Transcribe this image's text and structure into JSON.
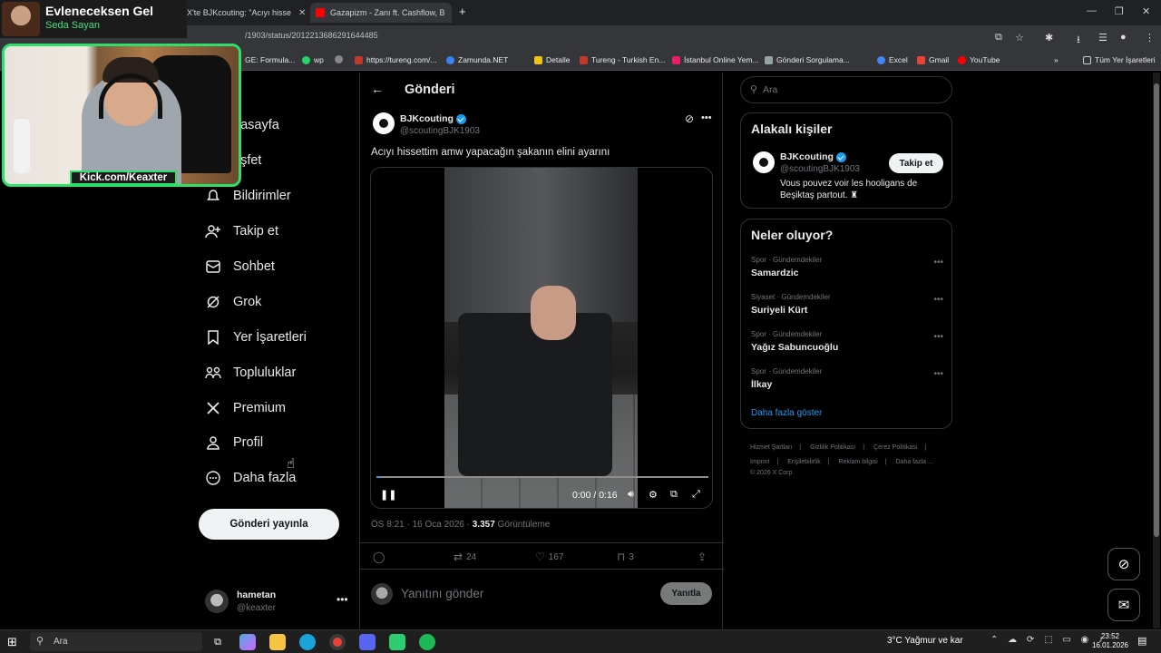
{
  "browser": {
    "tabs": [
      {
        "label": "X'te BJKcouting: \"Acıyı hisse",
        "favicon_color": "#000000"
      },
      {
        "label": "Gazapizm - Zanı ft. Cashflow, B",
        "favicon_color": "#ff0000"
      }
    ],
    "url": "/1903/status/2012213686291644485",
    "bookmarks": [
      {
        "label": "GE: Formula...",
        "color": "#e74c3c"
      },
      {
        "label": "wp",
        "color": "#25d366"
      },
      {
        "label": "https://tureng.com/...",
        "color": "#c0392b"
      },
      {
        "label": "Zamunda.NET",
        "color": "#3b82f6"
      },
      {
        "label": "Detalle",
        "color": "#f1c40f"
      },
      {
        "label": "Tureng - Turkish En...",
        "color": "#c0392b"
      },
      {
        "label": "İstanbul Online Yem...",
        "color": "#e91e63"
      },
      {
        "label": "Gönderi Sorgulama...",
        "color": "#95a5a6"
      },
      {
        "label": "Excel",
        "color": "#4285f4"
      },
      {
        "label": "Gmail",
        "color": "#ea4335"
      },
      {
        "label": "YouTube",
        "color": "#ff0000"
      }
    ],
    "all_bookmarks": "Tüm Yer İşaretleri"
  },
  "overlay": {
    "title": "Evleneceksen Gel",
    "subtitle": "Seda Sayan",
    "channel": "Kick.com/Keaxter"
  },
  "nav": {
    "items": [
      {
        "label": "nasayfa",
        "icon": "home-icon"
      },
      {
        "label": "eşfet",
        "icon": "explore-icon"
      },
      {
        "label": "Bildirimler",
        "icon": "bell-icon"
      },
      {
        "label": "Takip et",
        "icon": "follow-icon"
      },
      {
        "label": "Sohbet",
        "icon": "mail-icon"
      },
      {
        "label": "Grok",
        "icon": "grok-icon"
      },
      {
        "label": "Yer İşaretleri",
        "icon": "bookmark-icon"
      },
      {
        "label": "Topluluklar",
        "icon": "communities-icon"
      },
      {
        "label": "Premium",
        "icon": "x-logo-icon"
      },
      {
        "label": "Profil",
        "icon": "person-icon"
      },
      {
        "label": "Daha fazla",
        "icon": "more-circle-icon"
      }
    ],
    "post_button": "Gönderi yayınla",
    "account": {
      "name": "hametan",
      "handle": "@keaxter"
    }
  },
  "post": {
    "page_title": "Gönderi",
    "author": "BJKcouting",
    "handle": "@scoutingBJK1903",
    "text": "Acıyı hissettim amw yapacağın şakanın elini ayarını",
    "video_time": "0:00 / 0:16",
    "video_progress": 0.01,
    "timestamp": "ÖS 8:21 · 16 Oca 2026 · ",
    "views": "3.357",
    "views_label": " Görüntüleme",
    "retweets": "24",
    "likes": "167",
    "bookmarks": "3",
    "reply_placeholder": "Yanıtını gönder",
    "reply_button": "Yanıtla"
  },
  "sidebar": {
    "search_placeholder": "Ara",
    "related_title": "Alakalı kişiler",
    "related": {
      "name": "BJKcouting",
      "handle": "@scoutingBJK1903",
      "bio": "Vous pouvez voir les hooligans de Beşiktaş partout. ♜",
      "follow": "Takip et"
    },
    "trends_title": "Neler oluyor?",
    "trends": [
      {
        "category": "Spor · Gündemdekiler",
        "name": "Samardzic"
      },
      {
        "category": "Siyaset · Gündemdekiler",
        "name": "Suriyeli Kürt"
      },
      {
        "category": "Spor · Gündemdekiler",
        "name": "Yağız Sabuncuoğlu"
      },
      {
        "category": "Spor · Gündemdekiler",
        "name": "İlkay"
      }
    ],
    "show_more": "Daha fazla göster",
    "footer": [
      "Hizmet Şartları",
      "|",
      "Gizlilik Politikası",
      "|",
      "Çerez Politikası",
      "|",
      "Imprint",
      "|",
      "Erişilebilirlik",
      "|",
      "Reklam bilgisi",
      "|",
      "Daha fazla ...",
      "© 2026 X Corp."
    ]
  },
  "taskbar": {
    "search_placeholder": "Ara",
    "weather": "3°C  Yağmur ve kar",
    "time": "23:52",
    "date": "16.01.2026"
  }
}
